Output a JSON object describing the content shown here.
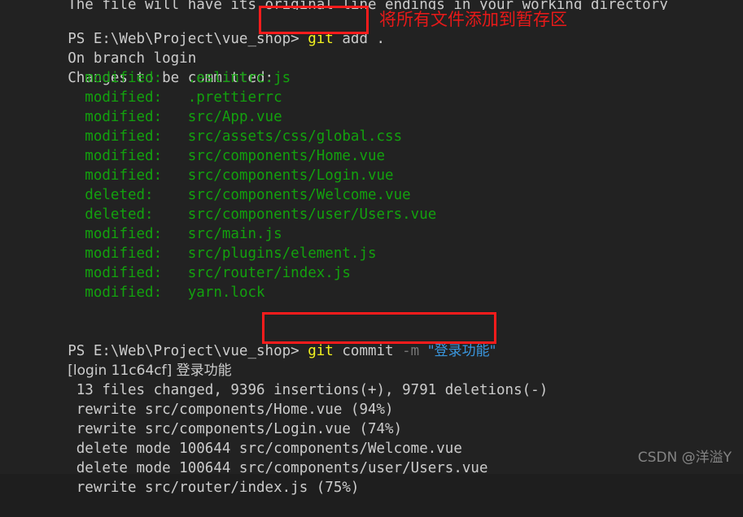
{
  "terminal": {
    "background_color": "#222222",
    "default_text_color": "#cccccc",
    "shell": "PowerShell",
    "scrollback_top_partial": "The file will have its original line endings in your working directory",
    "prompt_add": "PS E:\\Web\\Project\\vue_shop> ",
    "prompt_commit": "PS E:\\Web\\Project\\vue_shop> ",
    "cmd_add": {
      "command": "git",
      "args": " add ."
    },
    "cmd_commit": {
      "command": "git",
      "subcommand": " commit ",
      "flag": "-m",
      "space": " ",
      "message": "\"登录功能\""
    },
    "branch_line": "On branch login",
    "changes_header": "Changes to be committed:",
    "staged_indent": "        ",
    "staged_files": [
      {
        "status": "modified:",
        "gap": "   ",
        "path": ".eslintrc.js"
      },
      {
        "status": "modified:",
        "gap": "   ",
        "path": ".prettierrc"
      },
      {
        "status": "modified:",
        "gap": "   ",
        "path": "src/App.vue"
      },
      {
        "status": "modified:",
        "gap": "   ",
        "path": "src/assets/css/global.css"
      },
      {
        "status": "modified:",
        "gap": "   ",
        "path": "src/components/Home.vue"
      },
      {
        "status": "modified:",
        "gap": "   ",
        "path": "src/components/Login.vue"
      },
      {
        "status": "deleted:",
        "gap": "    ",
        "path": "src/components/Welcome.vue"
      },
      {
        "status": "deleted:",
        "gap": "    ",
        "path": "src/components/user/Users.vue"
      },
      {
        "status": "modified:",
        "gap": "   ",
        "path": "src/main.js"
      },
      {
        "status": "modified:",
        "gap": "   ",
        "path": "src/plugins/element.js"
      },
      {
        "status": "modified:",
        "gap": "   ",
        "path": "src/router/index.js"
      },
      {
        "status": "modified:",
        "gap": "   ",
        "path": "yarn.lock"
      }
    ],
    "commit_result": {
      "ref_line": "[login 11c64cf] 登录功能",
      "stat_line": " 13 files changed, 9396 insertions(+), 9791 deletions(-)",
      "detail_lines": [
        " rewrite src/components/Home.vue (94%)",
        " rewrite src/components/Login.vue (74%)",
        " delete mode 100644 src/components/Welcome.vue",
        " delete mode 100644 src/components/user/Users.vue",
        " rewrite src/router/index.js (75%)"
      ]
    }
  },
  "annotations": {
    "box_color": "#fb1c1c",
    "text_color": "#e81919",
    "add_note": "将所有文件添加到暂存区"
  },
  "watermark": {
    "text": "CSDN @洋溢Y"
  }
}
